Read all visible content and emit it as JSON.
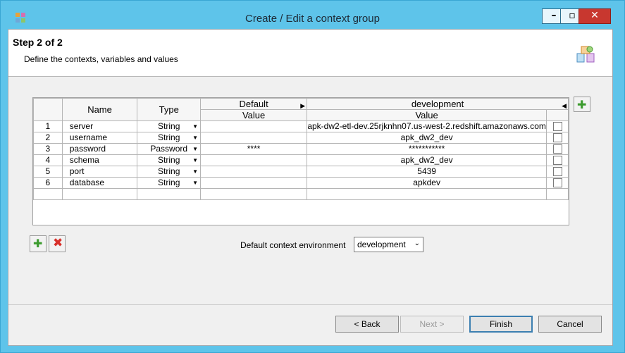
{
  "window": {
    "title": "Create / Edit a context group",
    "controls": {
      "minimize": "–",
      "maximize": "▫",
      "close": "✕"
    }
  },
  "header": {
    "step": "Step 2 of 2",
    "description": "Define the contexts, variables and values"
  },
  "table": {
    "columns": {
      "name": "Name",
      "type": "Type",
      "default_group": "Default",
      "development_group": "development",
      "value": "Value"
    },
    "rows": [
      {
        "num": "1",
        "name": "server",
        "type": "String",
        "default": "",
        "development": "apk-dw2-etl-dev.25rjknhn07.us-west-2.redshift.amazonaws.com"
      },
      {
        "num": "2",
        "name": "username",
        "type": "String",
        "default": "",
        "development": "apk_dw2_dev"
      },
      {
        "num": "3",
        "name": "password",
        "type": "Password",
        "default": "****",
        "development": "***********"
      },
      {
        "num": "4",
        "name": "schema",
        "type": "String",
        "default": "",
        "development": "apk_dw2_dev"
      },
      {
        "num": "5",
        "name": "port",
        "type": "String",
        "default": "",
        "development": "5439"
      },
      {
        "num": "6",
        "name": "database",
        "type": "String",
        "default": "",
        "development": "apkdev"
      }
    ]
  },
  "environment": {
    "label": "Default context environment",
    "selected": "development"
  },
  "buttons": {
    "back": "< Back",
    "next": "Next >",
    "finish": "Finish",
    "cancel": "Cancel"
  },
  "icons": {
    "add": "plus-icon",
    "remove": "x-icon",
    "wizard": "context-group-icon"
  },
  "colors": {
    "titlebar": "#5ec4ea",
    "add": "#3c9b2e",
    "remove": "#d8302a"
  }
}
